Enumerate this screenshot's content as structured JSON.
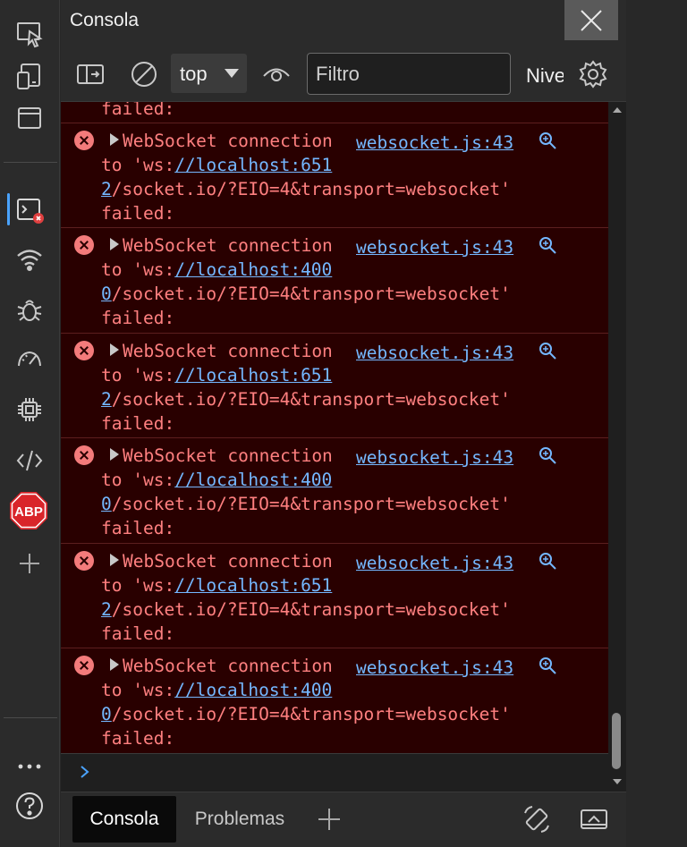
{
  "panel": {
    "title": "Consola",
    "context_selector": "top",
    "filter_placeholder": "Filtro",
    "levels_label": "Niveles predeterminados"
  },
  "messages": [
    {
      "partial": true,
      "line3": "failed:"
    },
    {
      "line1": "WebSocket connection",
      "line2_prefix": "to 'ws:",
      "line2_link": "//localhost:651",
      "line3_link": "2",
      "line3_rest": "/socket.io/?EIO=4&transport=websocket'",
      "line4": "failed:",
      "source": "websocket.js:43"
    },
    {
      "line1": "WebSocket connection",
      "line2_prefix": "to 'ws:",
      "line2_link": "//localhost:400",
      "line3_link": "0",
      "line3_rest": "/socket.io/?EIO=4&transport=websocket'",
      "line4": "failed:",
      "source": "websocket.js:43"
    },
    {
      "line1": "WebSocket connection",
      "line2_prefix": "to 'ws:",
      "line2_link": "//localhost:651",
      "line3_link": "2",
      "line3_rest": "/socket.io/?EIO=4&transport=websocket'",
      "line4": "failed:",
      "source": "websocket.js:43"
    },
    {
      "line1": "WebSocket connection",
      "line2_prefix": "to 'ws:",
      "line2_link": "//localhost:400",
      "line3_link": "0",
      "line3_rest": "/socket.io/?EIO=4&transport=websocket'",
      "line4": "failed:",
      "source": "websocket.js:43"
    },
    {
      "line1": "WebSocket connection",
      "line2_prefix": "to 'ws:",
      "line2_link": "//localhost:651",
      "line3_link": "2",
      "line3_rest": "/socket.io/?EIO=4&transport=websocket'",
      "line4": "failed:",
      "source": "websocket.js:43"
    },
    {
      "line1": "WebSocket connection",
      "line2_prefix": "to 'ws:",
      "line2_link": "//localhost:400",
      "line3_link": "0",
      "line3_rest": "/socket.io/?EIO=4&transport=websocket'",
      "line4": "failed:",
      "source": "websocket.js:43"
    }
  ],
  "bottom_tabs": [
    "Consola",
    "Problemas"
  ],
  "icons": {
    "activity": [
      "inspect-icon",
      "device-emulation-icon",
      "browser-window-icon",
      "console-icon",
      "network-icon",
      "bug-icon",
      "performance-icon",
      "chip-icon",
      "code-icon",
      "abp-icon",
      "add-icon",
      "more-icon",
      "help-icon"
    ]
  },
  "abp_text": "ABP",
  "colors": {
    "error_bg": "#290000",
    "error_text": "#ff8080",
    "link": "#74b7ff",
    "accent": "#4aa3ff"
  }
}
